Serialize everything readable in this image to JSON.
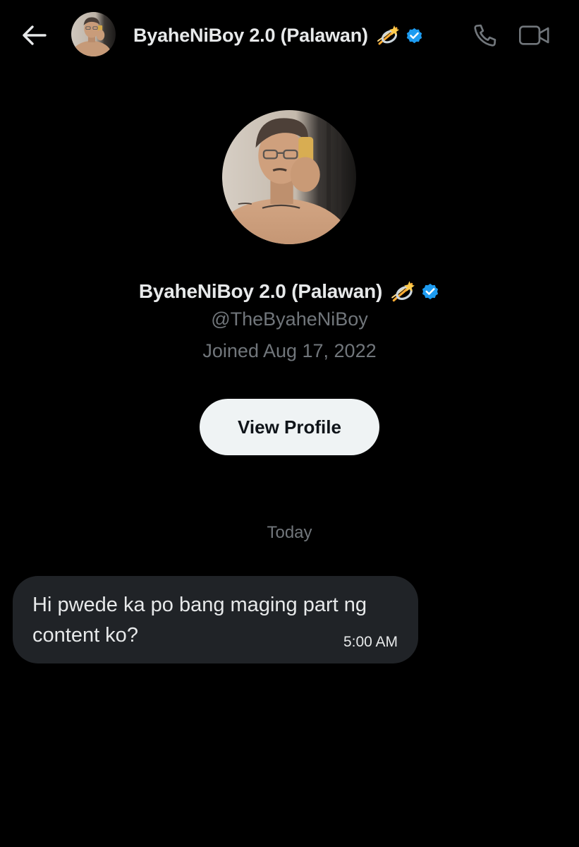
{
  "header": {
    "name": "ByaheNiBoy 2.0 (Palawan)",
    "name_emoji": "dizzy-icon",
    "verified_icon": "verified-badge-icon",
    "verified_color": "#1d9bf0",
    "back_icon": "arrow-left-icon",
    "call_icon": "phone-icon",
    "video_icon": "video-camera-icon"
  },
  "profile": {
    "name": "ByaheNiBoy 2.0 (Palawan)",
    "handle": "@TheByaheNiBoy",
    "joined": "Joined Aug 17, 2022",
    "view_profile_label": "View Profile"
  },
  "conversation": {
    "date_separator": "Today",
    "messages": [
      {
        "text": "Hi pwede ka po bang maging part ng content ko?",
        "time": "5:00 AM"
      }
    ]
  },
  "colors": {
    "background": "#000000",
    "primary_text": "#e7e9ea",
    "secondary_text": "#71767b",
    "bubble": "#202327",
    "button_bg": "#eff3f4",
    "button_text": "#0f1419"
  }
}
